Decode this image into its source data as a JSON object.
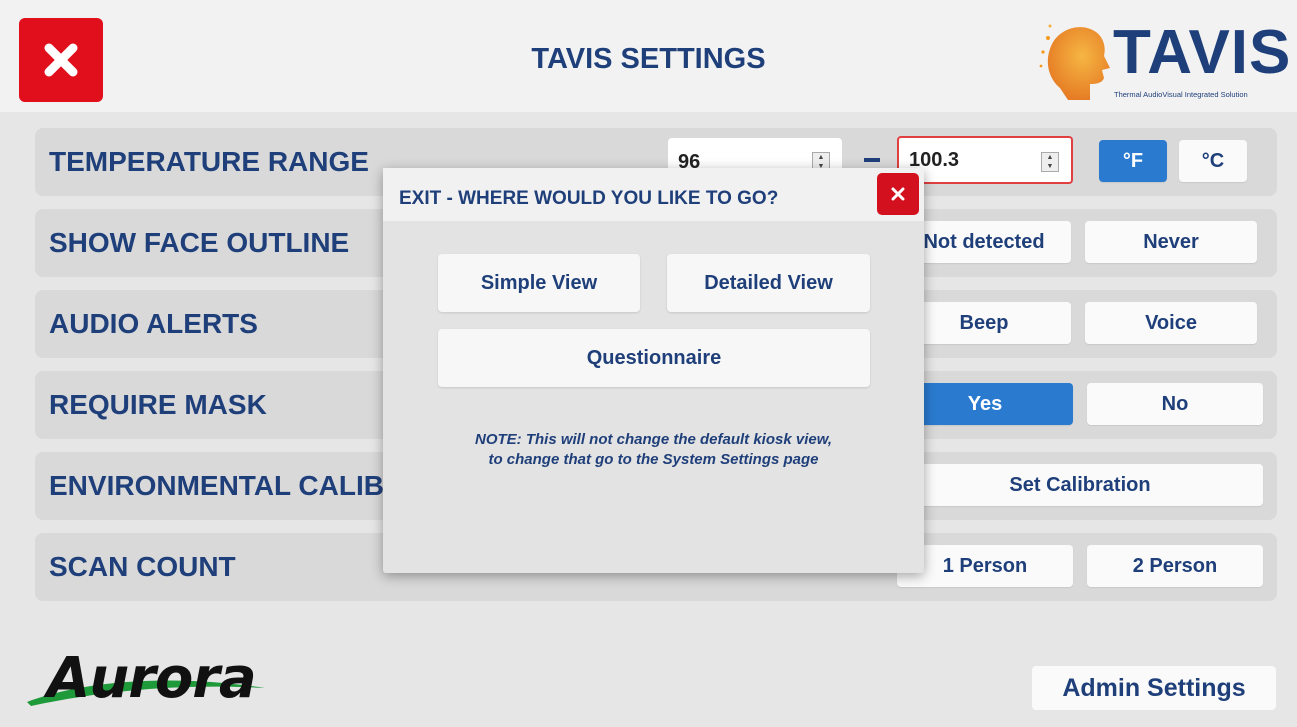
{
  "header": {
    "title": "TAVIS SETTINGS",
    "close_icon": "close-x-icon",
    "logo": {
      "word": "TAVIS",
      "tagline": "Thermal AudioVisual Integrated Solution"
    }
  },
  "rows": {
    "temperature": {
      "label": "TEMPERATURE RANGE",
      "min_value": "96",
      "max_value": "100.3",
      "unit_f": "°F",
      "unit_c": "°C",
      "selected_unit": "°F"
    },
    "face_outline": {
      "label": "SHOW FACE OUTLINE",
      "opt1": "Not detected",
      "opt2": "Never"
    },
    "audio_alerts": {
      "label": "AUDIO ALERTS",
      "opt1": "Beep",
      "opt2": "Voice"
    },
    "require_mask": {
      "label": "REQUIRE MASK",
      "opt1": "Yes",
      "opt2": "No",
      "selected": "Yes"
    },
    "env_calibration": {
      "label": "ENVIRONMENTAL CALIBRATION",
      "button": "Set Calibration"
    },
    "scan_count": {
      "label": "SCAN COUNT",
      "opt1": "1 Person",
      "opt2": "2 Person"
    }
  },
  "footer": {
    "brand": "Aurora",
    "admin_button": "Admin Settings"
  },
  "modal": {
    "title": "EXIT - WHERE WOULD YOU LIKE TO GO?",
    "simple_view": "Simple View",
    "detailed_view": "Detailed View",
    "questionnaire": "Questionnaire",
    "note_line1": "NOTE: This will not change the default kiosk view,",
    "note_line2": "to change that go to the System Settings page"
  },
  "colors": {
    "accent_blue": "#2a7bd0",
    "title_navy": "#1f3f7a",
    "close_red": "#e10e1c",
    "logo_orange": "#f39a1e"
  }
}
